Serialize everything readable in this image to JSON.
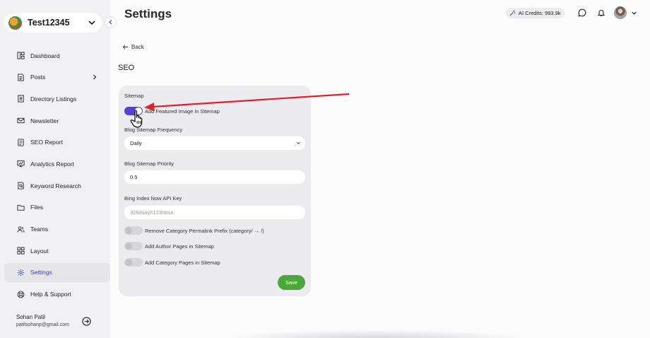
{
  "workspace": {
    "name": "Test12345"
  },
  "sidebar": {
    "items": [
      {
        "label": "Dashboard",
        "icon": "dashboard-icon"
      },
      {
        "label": "Posts",
        "icon": "posts-icon"
      },
      {
        "label": "Directory Listings",
        "icon": "directory-icon"
      },
      {
        "label": "Newsletter",
        "icon": "mail-icon"
      },
      {
        "label": "SEO Report",
        "icon": "report-icon"
      },
      {
        "label": "Analytics Report",
        "icon": "analytics-icon"
      },
      {
        "label": "Keyword Research",
        "icon": "keyword-icon"
      },
      {
        "label": "Files",
        "icon": "folder-icon"
      },
      {
        "label": "Teams",
        "icon": "users-icon"
      },
      {
        "label": "Layout",
        "icon": "layout-icon"
      },
      {
        "label": "Settings",
        "icon": "gear-icon",
        "active": true
      },
      {
        "label": "Help & Support",
        "icon": "help-icon"
      }
    ],
    "user": {
      "name": "Sohan Patil",
      "email": "patilsohanp@gmail.com"
    }
  },
  "header": {
    "title": "Settings",
    "credits": "AI Credits: 993.9k"
  },
  "content": {
    "back": "Back",
    "section": "SEO",
    "sitemap": {
      "label": "Sitemap",
      "featured_image_toggle": {
        "label": "Add Featured Image in Sitemap",
        "on": true
      },
      "frequency": {
        "label": "Blog Sitemap Frequency",
        "value": "Daily"
      },
      "priority": {
        "label": "Blog Sitemap Priority",
        "value": "0.5"
      },
      "bing_key": {
        "label": "Bing Index Now API Key",
        "placeholder": "326dsayh123hbsa"
      },
      "remove_category_toggle": {
        "label": "Remove Category Permalink Prefix (category/ → /)",
        "on": false
      },
      "author_pages_toggle": {
        "label": "Add Author Pages in Sitemap",
        "on": false
      },
      "category_pages_toggle": {
        "label": "Add Category Pages in Sitemap",
        "on": false
      },
      "save_label": "Save"
    }
  },
  "colors": {
    "accent": "#5a3fd6",
    "save": "#4aa83a",
    "annotation": "#e0202a"
  }
}
